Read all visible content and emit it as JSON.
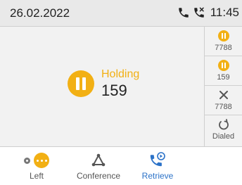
{
  "status_bar": {
    "date": "26.02.2022",
    "time": "11:45",
    "icons": [
      "phone-icon",
      "missed-call-icon"
    ]
  },
  "call": {
    "state": "Holding",
    "number": "159",
    "icon": "hold-icon"
  },
  "sidebar": {
    "items": [
      {
        "icon": "hold-icon",
        "label": "7788"
      },
      {
        "icon": "hold-icon",
        "label": "159"
      },
      {
        "icon": "close-icon",
        "label": "7788"
      },
      {
        "icon": "redial-icon",
        "label": "Dialed"
      }
    ]
  },
  "softkeys": {
    "left": "Left",
    "conference": "Conference",
    "retrieve": "Retrieve"
  },
  "colors": {
    "hold": "#f2b014",
    "accent": "#2b72c8",
    "statusbar": "#e9e9e9",
    "panel": "#f2f2f2"
  }
}
